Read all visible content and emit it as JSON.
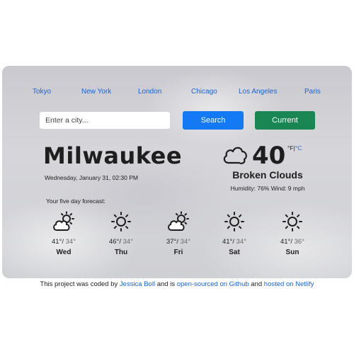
{
  "nav": {
    "cities": [
      "Tokyo",
      "New York",
      "London",
      "Chicago",
      "Los Angeles",
      "Paris"
    ]
  },
  "search": {
    "placeholder": "Enter a city...",
    "value": "",
    "search_label": "Search",
    "current_label": "Current"
  },
  "weather": {
    "city": "Milwaukee",
    "date_time": "Wednesday, January 31, 02:30 PM",
    "temperature": "40",
    "unit_f": "°F",
    "unit_sep": "|",
    "unit_c": "°C",
    "description": "Broken Clouds",
    "details": "Humidity: 76% Wind: 9 mph",
    "icon": "broken-clouds-icon"
  },
  "forecast": {
    "title": "Your five day forecast:",
    "days": [
      {
        "day": "Wed",
        "high": "41°",
        "low": "34°",
        "icon": "partly-cloudy-icon"
      },
      {
        "day": "Thu",
        "high": "46°",
        "low": "34°",
        "icon": "sun-icon"
      },
      {
        "day": "Fri",
        "high": "37°",
        "low": "34°",
        "icon": "partly-cloudy-icon"
      },
      {
        "day": "Sat",
        "high": "41°",
        "low": "34°",
        "icon": "sun-icon"
      },
      {
        "day": "Sun",
        "high": "41°",
        "low": "36°",
        "icon": "sun-icon"
      }
    ]
  },
  "footer": {
    "text_1": "This project was coded by",
    "author": "Jessica Boll",
    "text_2": "and is",
    "github": "open-sourced on Github",
    "text_3": "and",
    "netlify": "hosted on Netlify"
  },
  "colors": {
    "link": "#1a63e0",
    "search_button": "#1479f5",
    "current_button": "#198654"
  }
}
